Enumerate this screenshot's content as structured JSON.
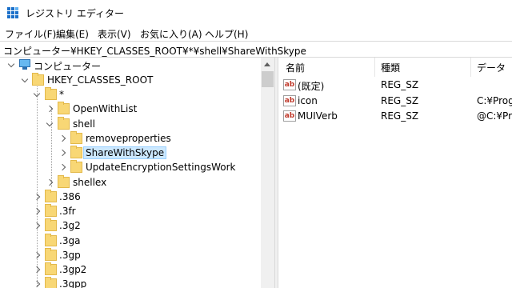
{
  "window": {
    "title": "レジストリ エディター",
    "app_icon": "registry-editor-icon"
  },
  "menu": [
    {
      "label": "ファイル(F)"
    },
    {
      "label": "編集(E)"
    },
    {
      "label": "表示(V)"
    },
    {
      "label": "お気に入り(A)"
    },
    {
      "label": "ヘルプ(H)"
    }
  ],
  "address": {
    "path": "コンピューター¥HKEY_CLASSES_ROOT¥*¥shell¥ShareWithSkype"
  },
  "tree": {
    "root": {
      "label": "コンピューター",
      "icon": "computer-icon",
      "state": "expanded"
    },
    "nodes": [
      {
        "label": "HKEY_CLASSES_ROOT",
        "state": "expanded"
      },
      {
        "label": "*",
        "state": "expanded"
      },
      {
        "label": "OpenWithList",
        "state": "collapsed"
      },
      {
        "label": "shell",
        "state": "expanded"
      },
      {
        "label": "removeproperties",
        "state": "collapsed"
      },
      {
        "label": "ShareWithSkype",
        "state": "collapsed",
        "selected": true
      },
      {
        "label": "UpdateEncryptionSettingsWork",
        "state": "collapsed"
      },
      {
        "label": "shellex",
        "state": "collapsed"
      },
      {
        "label": ".386",
        "state": "collapsed"
      },
      {
        "label": ".3fr",
        "state": "collapsed"
      },
      {
        "label": ".3g2",
        "state": "collapsed"
      },
      {
        "label": ".3ga",
        "state": "none"
      },
      {
        "label": ".3gp",
        "state": "collapsed"
      },
      {
        "label": ".3gp2",
        "state": "collapsed"
      },
      {
        "label": ".3gpp",
        "state": "collapsed"
      }
    ]
  },
  "list": {
    "columns": [
      {
        "label": "名前"
      },
      {
        "label": "種類"
      },
      {
        "label": "データ"
      }
    ],
    "rows": [
      {
        "name": "(既定)",
        "type": "REG_SZ",
        "data": "",
        "icon": "string-value-icon"
      },
      {
        "name": "icon",
        "type": "REG_SZ",
        "data": "C:¥Progr",
        "icon": "string-value-icon"
      },
      {
        "name": "MUIVerb",
        "type": "REG_SZ",
        "data": "@C:¥Pro",
        "icon": "string-value-icon"
      }
    ]
  },
  "colors": {
    "selection_bg": "#cce8ff",
    "selection_border": "#99d1ff",
    "folder": "#f8d775"
  }
}
